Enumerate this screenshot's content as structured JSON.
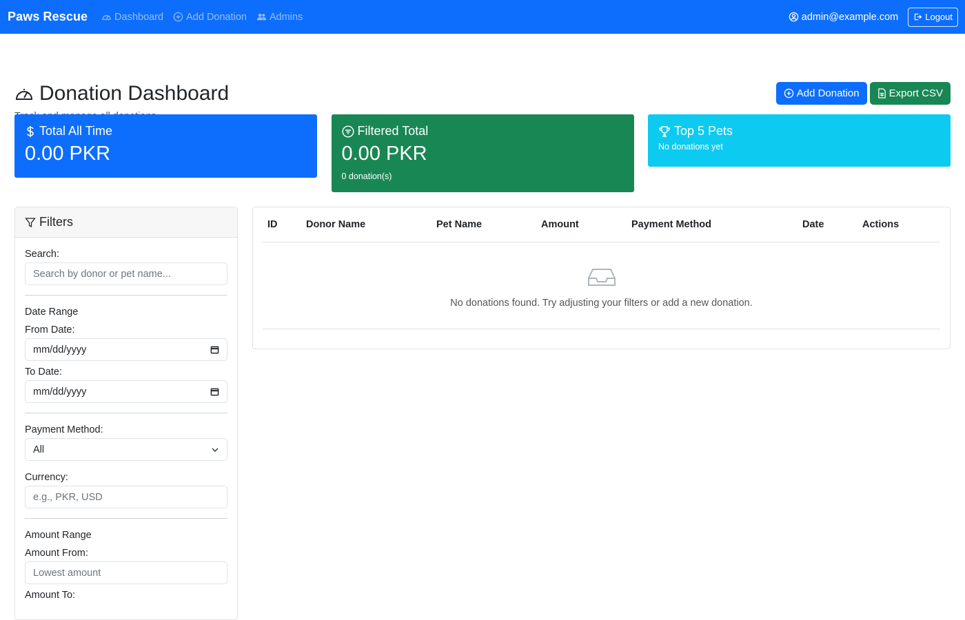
{
  "navbar": {
    "brand": "Paws Rescue",
    "links": [
      {
        "label": "Dashboard",
        "icon": "speedometer-icon"
      },
      {
        "label": "Add Donation",
        "icon": "plus-circle-icon"
      },
      {
        "label": "Admins",
        "icon": "people-icon"
      }
    ],
    "user_email": "admin@example.com",
    "logout_label": "Logout"
  },
  "header": {
    "title": "Donation Dashboard",
    "subtitle": "Track and manage all donations",
    "add_button": "Add Donation",
    "export_button": "Export CSV"
  },
  "cards": {
    "total": {
      "title": "Total All Time",
      "value": "0.00 PKR",
      "icon": "dollar-icon"
    },
    "filtered": {
      "title": "Filtered Total",
      "value": "0.00 PKR",
      "sub": "0 donation(s)",
      "icon": "filter-circle-icon"
    },
    "top": {
      "title": "Top 5 Pets",
      "sub": "No donations yet",
      "icon": "trophy-icon"
    }
  },
  "filters": {
    "title": "Filters",
    "search_label": "Search:",
    "search_placeholder": "Search by donor or pet name...",
    "date_range_label": "Date Range",
    "from_label": "From Date:",
    "from_value": "mm/dd/yyyy",
    "to_label": "To Date:",
    "to_value": "mm/dd/yyyy",
    "payment_label": "Payment Method:",
    "payment_value": "All",
    "currency_label": "Currency:",
    "currency_placeholder": "e.g., PKR, USD",
    "amount_range_label": "Amount Range",
    "amount_from_label": "Amount From:",
    "amount_from_placeholder": "Lowest amount",
    "amount_to_label": "Amount To:"
  },
  "table": {
    "columns": [
      "ID",
      "Donor Name",
      "Pet Name",
      "Amount",
      "Payment Method",
      "Date",
      "Actions"
    ],
    "empty_text": "No donations found. Try adjusting your filters or add a new donation."
  },
  "colors": {
    "primary": "#0d6efd",
    "success": "#198754",
    "info": "#0dcaf0"
  }
}
